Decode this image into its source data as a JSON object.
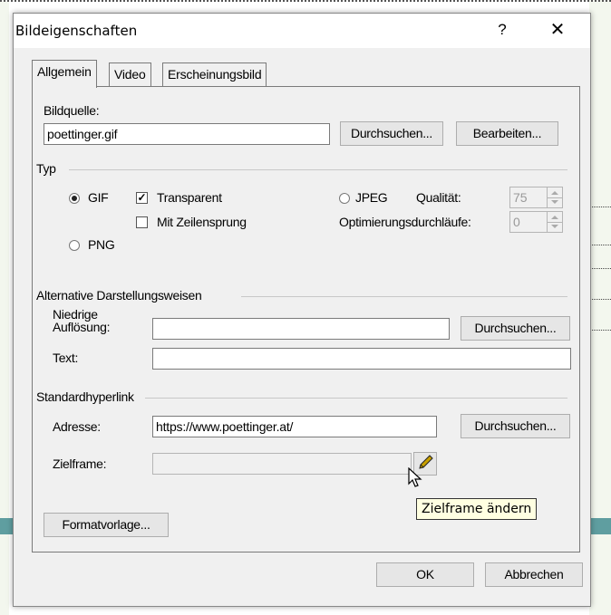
{
  "dialog": {
    "title": "Bildeigenschaften",
    "help_label": "?",
    "close_label": "✕"
  },
  "tabs": [
    {
      "label": "Allgemein",
      "active": true
    },
    {
      "label": "Video",
      "active": false
    },
    {
      "label": "Erscheinungsbild",
      "active": false
    }
  ],
  "source": {
    "label": "Bildquelle:",
    "value": "poettinger.gif",
    "browse_label": "Durchsuchen...",
    "edit_label": "Bearbeiten..."
  },
  "type": {
    "group_label": "Typ",
    "gif_label": "GIF",
    "gif_checked": true,
    "transparent_label": "Transparent",
    "transparent_checked": true,
    "interlaced_label": "Mit Zeilensprung",
    "interlaced_checked": false,
    "png_label": "PNG",
    "png_checked": false,
    "jpeg_label": "JPEG",
    "jpeg_checked": false,
    "quality_label": "Qualität:",
    "quality_value": "75",
    "passes_label": "Optimierungsdurchläufe:",
    "passes_value": "0"
  },
  "alternatives": {
    "group_label": "Alternative Darstellungsweisen",
    "lowres_label_line1": "Niedrige",
    "lowres_label_line2": "Auflösung:",
    "lowres_value": "",
    "browse_label": "Durchsuchen...",
    "text_label": "Text:",
    "text_value": ""
  },
  "hyperlink": {
    "group_label": "Standardhyperlink",
    "address_label": "Adresse:",
    "address_value": "https://www.poettinger.at/",
    "browse_label": "Durchsuchen...",
    "target_label": "Zielframe:",
    "target_value": "",
    "edit_target_icon": "pencil-icon",
    "tooltip": "Zielframe ändern"
  },
  "style_button_label": "Formatvorlage...",
  "footer": {
    "ok_label": "OK",
    "cancel_label": "Abbrechen"
  }
}
